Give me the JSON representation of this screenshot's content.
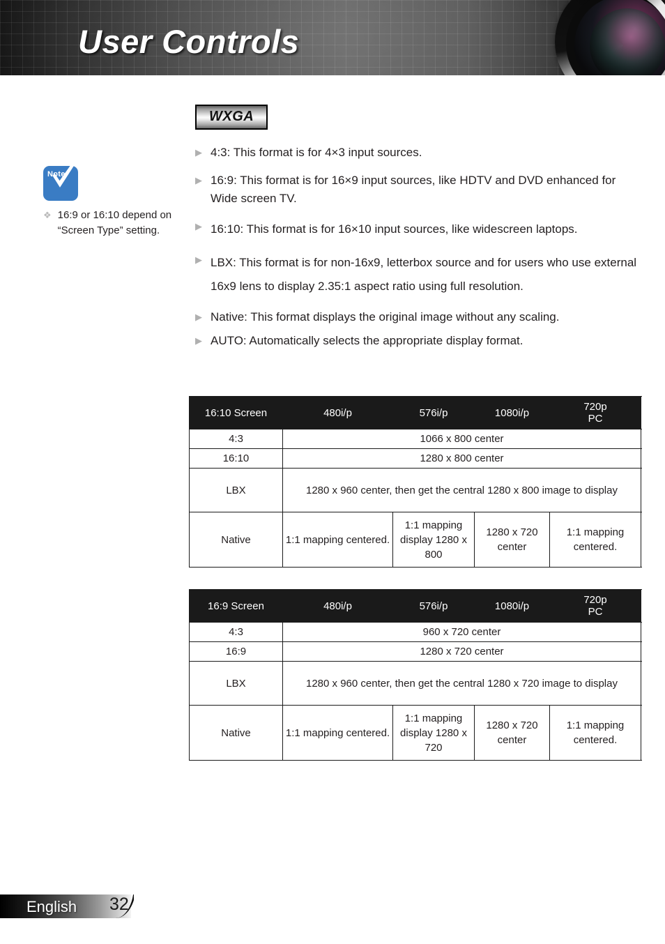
{
  "header": {
    "title": "User Controls",
    "lens_icon": "camera-lens-graphic"
  },
  "note": {
    "icon_label": "Note",
    "icon_name": "note-check-icon",
    "bullet_glyph": "❖",
    "items": [
      "16:9 or 16:10 depend on “Screen Type” setting."
    ]
  },
  "main": {
    "badge": "WXGA",
    "bullet_glyph": "▶",
    "bullets": [
      "4:3: This format is for 4×3 input sources.",
      "16:9: This format is for 16×9 input sources, like HDTV and DVD enhanced for Wide screen TV.",
      "16:10: This format is for 16×10 input sources, like widescreen laptops.",
      "LBX: This format is for non-16x9, letterbox source and for users who use external 16x9 lens to display 2.35:1 aspect ratio using full resolution.",
      "Native: This format displays the original image without any scaling.",
      "AUTO: Automatically selects the appropriate display format."
    ]
  },
  "tables": [
    {
      "name": "16:10 Screen",
      "headers": [
        "16:10 Screen",
        "480i/p",
        "576i/p",
        "1080i/p",
        "720p",
        "PC"
      ],
      "rows": [
        {
          "label": "4:3",
          "cells": [
            "1066 x 800 center"
          ]
        },
        {
          "label": "16:10",
          "cells": [
            "1280 x 800 center"
          ]
        },
        {
          "label": "LBX",
          "cells": [
            "1280 x 960 center, then get the central 1280 x 800 image to display"
          ]
        },
        {
          "label": "Native",
          "cells": [
            "1:1 mapping centered.",
            "1:1 mapping display 1280 x 800",
            "1280 x 720 center",
            "1:1 mapping centered."
          ]
        }
      ]
    },
    {
      "name": "16:9 Screen",
      "headers": [
        "16:9 Screen",
        "480i/p",
        "576i/p",
        "1080i/p",
        "720p",
        "PC"
      ],
      "rows": [
        {
          "label": "4:3",
          "cells": [
            "960 x 720 center"
          ]
        },
        {
          "label": "16:9",
          "cells": [
            "1280 x 720 center"
          ]
        },
        {
          "label": "LBX",
          "cells": [
            "1280 x 960 center, then get the central 1280 x 720 image to display"
          ]
        },
        {
          "label": "Native",
          "cells": [
            "1:1 mapping centered.",
            "1:1 mapping display 1280 x 720",
            "1280 x 720 center",
            "1:1 mapping centered."
          ]
        }
      ]
    }
  ],
  "footer": {
    "language": "English",
    "page_number": "32"
  },
  "colors": {
    "header_dark": "#1a1a1a",
    "note_blue": "#3a7cc4",
    "table_header_bg": "#1a1a1a",
    "text": "#231f20",
    "bullet_gray": "#b0b0b0"
  }
}
